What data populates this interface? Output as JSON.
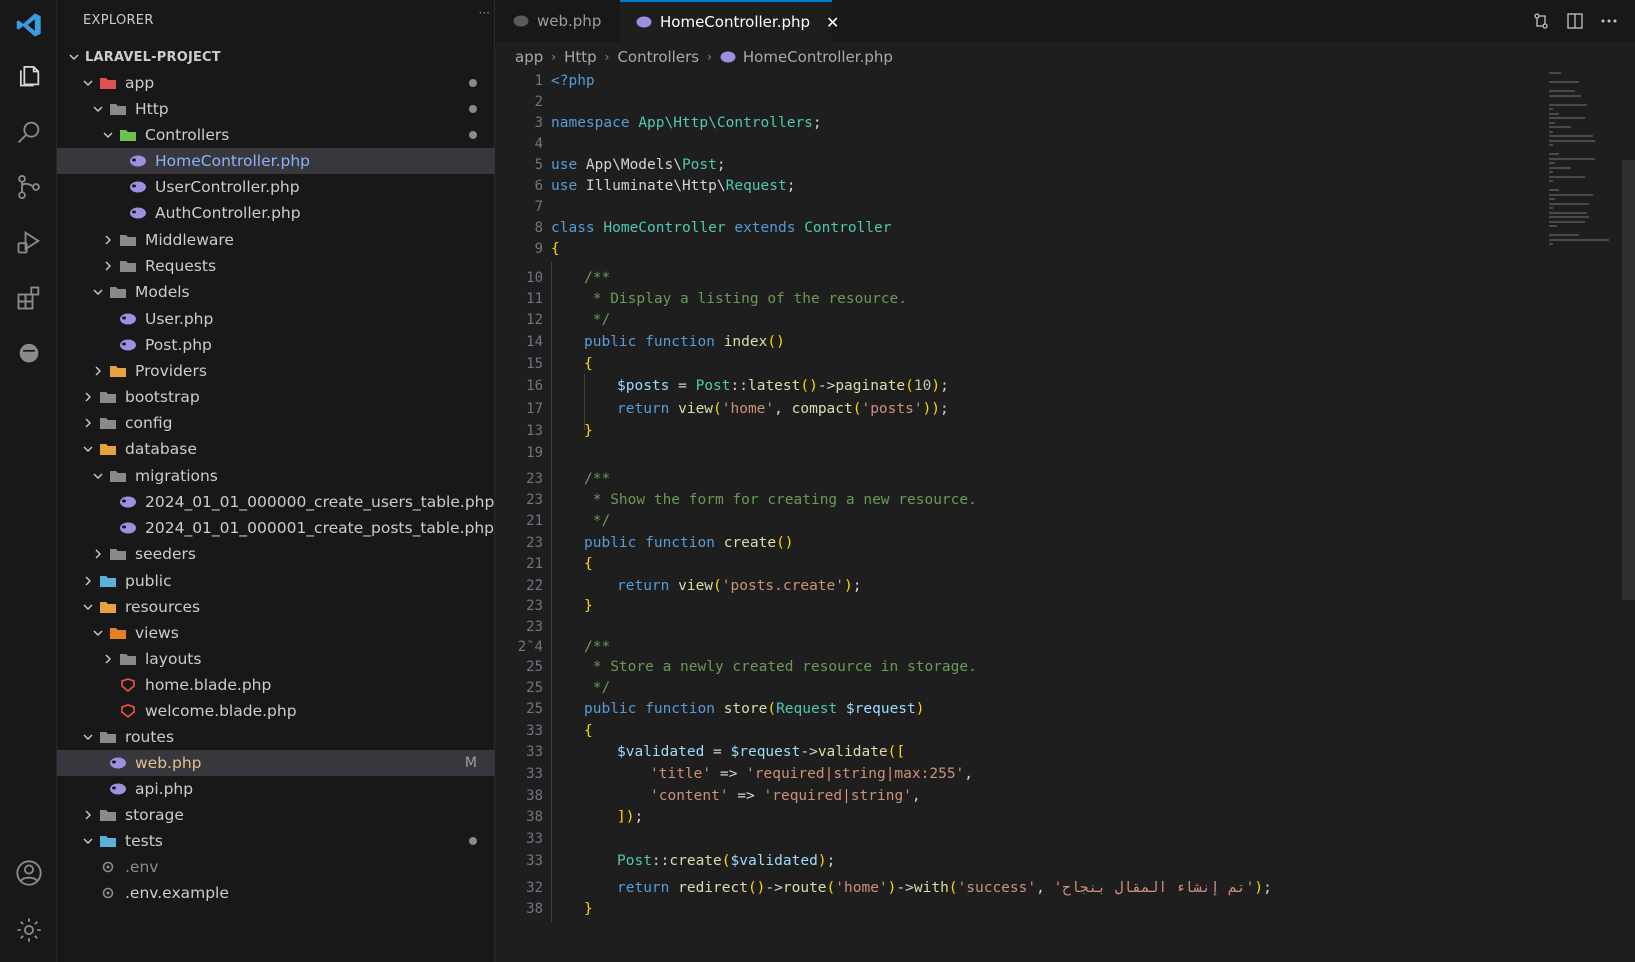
{
  "explorer": {
    "title": "EXPLORER",
    "more_glyph": "···",
    "project": "LARAVEL-PROJECT",
    "items": [
      {
        "label": "app",
        "depth": 1,
        "kind": "folder",
        "expanded": true,
        "folder_color": "#e05252",
        "dot": true
      },
      {
        "label": "Http",
        "depth": 2,
        "kind": "folder",
        "expanded": true,
        "folder_color": "#8a8a8a",
        "dot": true
      },
      {
        "label": "Controllers",
        "depth": 3,
        "kind": "folder",
        "expanded": true,
        "folder_color": "#6cc24a",
        "dot": true
      },
      {
        "label": "HomeController.php",
        "depth": 4,
        "kind": "php",
        "selected": true,
        "highlight": true
      },
      {
        "label": "UserController.php",
        "depth": 4,
        "kind": "php"
      },
      {
        "label": "AuthController.php",
        "depth": 4,
        "kind": "php"
      },
      {
        "label": "Middleware",
        "depth": 3,
        "kind": "folder",
        "expanded": false,
        "folder_color": "#8a8a8a"
      },
      {
        "label": "Requests",
        "depth": 3,
        "kind": "folder",
        "expanded": false,
        "folder_color": "#8a8a8a"
      },
      {
        "label": "Models",
        "depth": 2,
        "kind": "folder",
        "expanded": true,
        "folder_color": "#8a8a8a"
      },
      {
        "label": "User.php",
        "depth": 3,
        "kind": "php"
      },
      {
        "label": "Post.php",
        "depth": 3,
        "kind": "php"
      },
      {
        "label": "Providers",
        "depth": 2,
        "kind": "folder",
        "expanded": false,
        "folder_color": "#e6a23c"
      },
      {
        "label": "bootstrap",
        "depth": 1,
        "kind": "folder",
        "expanded": false,
        "folder_color": "#8a8a8a"
      },
      {
        "label": "config",
        "depth": 1,
        "kind": "folder",
        "expanded": false,
        "folder_color": "#8a8a8a"
      },
      {
        "label": "database",
        "depth": 1,
        "kind": "folder",
        "expanded": true,
        "folder_color": "#e6a23c"
      },
      {
        "label": "migrations",
        "depth": 2,
        "kind": "folder",
        "expanded": true,
        "folder_color": "#8a8a8a"
      },
      {
        "label": "2024_01_01_000000_create_users_table.php",
        "depth": 3,
        "kind": "php"
      },
      {
        "label": "2024_01_01_000001_create_posts_table.php",
        "depth": 3,
        "kind": "php"
      },
      {
        "label": "seeders",
        "depth": 2,
        "kind": "folder",
        "expanded": false,
        "folder_color": "#8a8a8a"
      },
      {
        "label": "public",
        "depth": 1,
        "kind": "folder",
        "expanded": false,
        "folder_color": "#5ab0d8"
      },
      {
        "label": "resources",
        "depth": 1,
        "kind": "folder",
        "expanded": true,
        "folder_color": "#e6a23c"
      },
      {
        "label": "views",
        "depth": 2,
        "kind": "folder",
        "expanded": true,
        "folder_color": "#e67e22"
      },
      {
        "label": "layouts",
        "depth": 3,
        "kind": "folder",
        "expanded": false,
        "folder_color": "#8a8a8a"
      },
      {
        "label": "home.blade.php",
        "depth": 3,
        "kind": "blade"
      },
      {
        "label": "welcome.blade.php",
        "depth": 3,
        "kind": "blade"
      },
      {
        "label": "routes",
        "depth": 1,
        "kind": "folder",
        "expanded": true,
        "folder_color": "#8a8a8a"
      },
      {
        "label": "web.php",
        "depth": 2,
        "kind": "php",
        "selected": true,
        "badge": "M"
      },
      {
        "label": "api.php",
        "depth": 2,
        "kind": "php"
      },
      {
        "label": "storage",
        "depth": 1,
        "kind": "folder",
        "expanded": false,
        "folder_color": "#8a8a8a"
      },
      {
        "label": "tests",
        "depth": 1,
        "kind": "folder",
        "expanded": true,
        "folder_color": "#5ab0d8",
        "dot": true
      },
      {
        "label": ".env",
        "depth": 1,
        "kind": "gear",
        "dim": true
      },
      {
        "label": ".env.example",
        "depth": 1,
        "kind": "gear"
      }
    ]
  },
  "tabs": [
    {
      "label": "web.php",
      "active": false
    },
    {
      "label": "HomeController.php",
      "active": true,
      "close": "✕"
    }
  ],
  "breadcrumb": [
    "app",
    "Http",
    "Controllers",
    "HomeController.php"
  ],
  "breadcrumb_sep": "›",
  "toolbar_icons": [
    "compare-changes-icon",
    "split-editor-icon",
    "more-actions-icon"
  ],
  "code": [
    {
      "n": "1",
      "indent": 0,
      "t": [
        [
          "kw",
          "<?php"
        ]
      ]
    },
    {
      "n": "2",
      "indent": 0,
      "t": []
    },
    {
      "n": "3",
      "indent": 0,
      "t": [
        [
          "kw",
          "namespace "
        ],
        [
          "cls",
          "App\\Http\\Controllers"
        ],
        [
          "br",
          ";"
        ]
      ]
    },
    {
      "n": "4",
      "indent": 0,
      "t": []
    },
    {
      "n": "5",
      "indent": 0,
      "t": [
        [
          "kw",
          "use "
        ],
        [
          "br",
          "App\\Models\\"
        ],
        [
          "cls",
          "Post"
        ],
        [
          "br",
          ";"
        ]
      ]
    },
    {
      "n": "6",
      "indent": 0,
      "t": [
        [
          "kw",
          "use "
        ],
        [
          "br",
          "Illuminate\\Http\\"
        ],
        [
          "cls",
          "Request"
        ],
        [
          "br",
          ";"
        ]
      ]
    },
    {
      "n": "7",
      "indent": 0,
      "t": []
    },
    {
      "n": "8",
      "indent": 0,
      "t": [
        [
          "kw",
          "class "
        ],
        [
          "cls",
          "HomeController "
        ],
        [
          "kw",
          "extends "
        ],
        [
          "cls",
          "Controller"
        ]
      ]
    },
    {
      "n": "9",
      "indent": 0,
      "t": [
        [
          "brk",
          "{"
        ]
      ]
    },
    {
      "n": "10",
      "indent": 1,
      "t": [
        [
          "cmt",
          "/**"
        ]
      ]
    },
    {
      "n": "11",
      "indent": 1,
      "t": [
        [
          "cmt",
          " * Display a listing of the resource."
        ]
      ]
    },
    {
      "n": "12",
      "indent": 1,
      "t": [
        [
          "cmt",
          " */"
        ]
      ]
    },
    {
      "n": "14",
      "indent": 1,
      "t": [
        [
          "kw",
          "public function "
        ],
        [
          "fn",
          "index"
        ],
        [
          "brk",
          "()"
        ]
      ]
    },
    {
      "n": "15",
      "indent": 1,
      "t": [
        [
          "brk",
          "{"
        ]
      ]
    },
    {
      "n": "16",
      "indent": 2,
      "t": [
        [
          "var",
          "$posts"
        ],
        [
          "br",
          " = "
        ],
        [
          "cls",
          "Post"
        ],
        [
          "br",
          "::"
        ],
        [
          "fn",
          "latest"
        ],
        [
          "brk",
          "()"
        ],
        [
          "br",
          "->"
        ],
        [
          "fn",
          "paginate"
        ],
        [
          "brk",
          "("
        ],
        [
          "num",
          "10"
        ],
        [
          "brk",
          ")"
        ],
        [
          "br",
          ";"
        ]
      ]
    },
    {
      "n": "17",
      "indent": 2,
      "t": [
        [
          "kw",
          "return "
        ],
        [
          "fn",
          "view"
        ],
        [
          "brk",
          "("
        ],
        [
          "str",
          "'home'"
        ],
        [
          "br",
          ", "
        ],
        [
          "fn",
          "compact"
        ],
        [
          "brk",
          "("
        ],
        [
          "str",
          "'posts'"
        ],
        [
          "brk",
          "))"
        ],
        [
          "br",
          ";"
        ]
      ]
    },
    {
      "n": "13",
      "indent": 1,
      "t": [
        [
          "brk",
          "}"
        ]
      ]
    },
    {
      "n": "19",
      "indent": 0,
      "t": []
    },
    {
      "n": "23",
      "indent": 1,
      "t": [
        [
          "cmt",
          "/**"
        ]
      ]
    },
    {
      "n": "23",
      "indent": 1,
      "t": [
        [
          "cmt",
          " * Show the form for creating a new resource."
        ]
      ]
    },
    {
      "n": "21",
      "indent": 1,
      "t": [
        [
          "cmt",
          " */"
        ]
      ]
    },
    {
      "n": "23",
      "indent": 1,
      "t": [
        [
          "kw",
          "public function "
        ],
        [
          "fn",
          "create"
        ],
        [
          "brk",
          "()"
        ]
      ]
    },
    {
      "n": "21",
      "indent": 1,
      "t": [
        [
          "brk",
          "{"
        ]
      ]
    },
    {
      "n": "2̈2",
      "indent": 2,
      "t": [
        [
          "kw",
          "return "
        ],
        [
          "fn",
          "view"
        ],
        [
          "brk",
          "("
        ],
        [
          "str",
          "'posts.create'"
        ],
        [
          "brk",
          ")"
        ],
        [
          "br",
          ";"
        ]
      ]
    },
    {
      "n": "23",
      "indent": 1,
      "t": [
        [
          "brk",
          "}"
        ]
      ]
    },
    {
      "n": "23",
      "indent": 0,
      "t": []
    },
    {
      "n": "2‶4",
      "indent": 1,
      "t": [
        [
          "cmt",
          "/**"
        ]
      ]
    },
    {
      "n": "25",
      "indent": 1,
      "t": [
        [
          "cmt",
          " * Store a newly created resource in storage."
        ]
      ]
    },
    {
      "n": "25",
      "indent": 1,
      "t": [
        [
          "cmt",
          " */"
        ]
      ]
    },
    {
      "n": "25",
      "indent": 1,
      "t": [
        [
          "kw",
          "public function "
        ],
        [
          "fn",
          "store"
        ],
        [
          "brk",
          "("
        ],
        [
          "cls",
          "Request "
        ],
        [
          "var",
          "$request"
        ],
        [
          "brk",
          ")"
        ]
      ]
    },
    {
      "n": "33",
      "indent": 1,
      "t": [
        [
          "brk",
          "{"
        ]
      ]
    },
    {
      "n": "33",
      "indent": 2,
      "t": [
        [
          "var",
          "$validated"
        ],
        [
          "br",
          " = "
        ],
        [
          "var",
          "$request"
        ],
        [
          "br",
          "->"
        ],
        [
          "fn",
          "validate"
        ],
        [
          "brk",
          "(["
        ]
      ]
    },
    {
      "n": "33",
      "indent": 3,
      "t": [
        [
          "str",
          "'title'"
        ],
        [
          "br",
          " => "
        ],
        [
          "str",
          "'required|string|max:255'"
        ],
        [
          "br",
          ","
        ]
      ]
    },
    {
      "n": "38",
      "indent": 3,
      "t": [
        [
          "str",
          "'content'"
        ],
        [
          "br",
          " => "
        ],
        [
          "str",
          "'required|string'"
        ],
        [
          "br",
          ","
        ]
      ]
    },
    {
      "n": "38",
      "indent": 2,
      "t": [
        [
          "brk",
          "])"
        ],
        [
          "br",
          ";"
        ]
      ]
    },
    {
      "n": "33",
      "indent": 0,
      "t": []
    },
    {
      "n": "33",
      "indent": 2,
      "t": [
        [
          "cls",
          "Post"
        ],
        [
          "br",
          "::"
        ],
        [
          "fn",
          "create"
        ],
        [
          "brk",
          "("
        ],
        [
          "var",
          "$validated"
        ],
        [
          "brk",
          ")"
        ],
        [
          "br",
          ";"
        ]
      ]
    },
    {
      "n": "32",
      "indent": 2,
      "t": [
        [
          "kw",
          "return "
        ],
        [
          "fn",
          "redirect"
        ],
        [
          "brk",
          "()"
        ],
        [
          "br",
          "->"
        ],
        [
          "fn",
          "route"
        ],
        [
          "brk",
          "("
        ],
        [
          "str",
          "'home'"
        ],
        [
          "brk",
          ")"
        ],
        [
          "br",
          "->"
        ],
        [
          "fn",
          "with"
        ],
        [
          "brk",
          "("
        ],
        [
          "str",
          "'success'"
        ],
        [
          "br",
          ", "
        ],
        [
          "str",
          "'تم إنشاء المقال بنجاح'"
        ],
        [
          "brk",
          ")"
        ],
        [
          "br",
          ";"
        ]
      ]
    },
    {
      "n": "38",
      "indent": 1,
      "t": [
        [
          "brk",
          "}"
        ]
      ]
    }
  ]
}
